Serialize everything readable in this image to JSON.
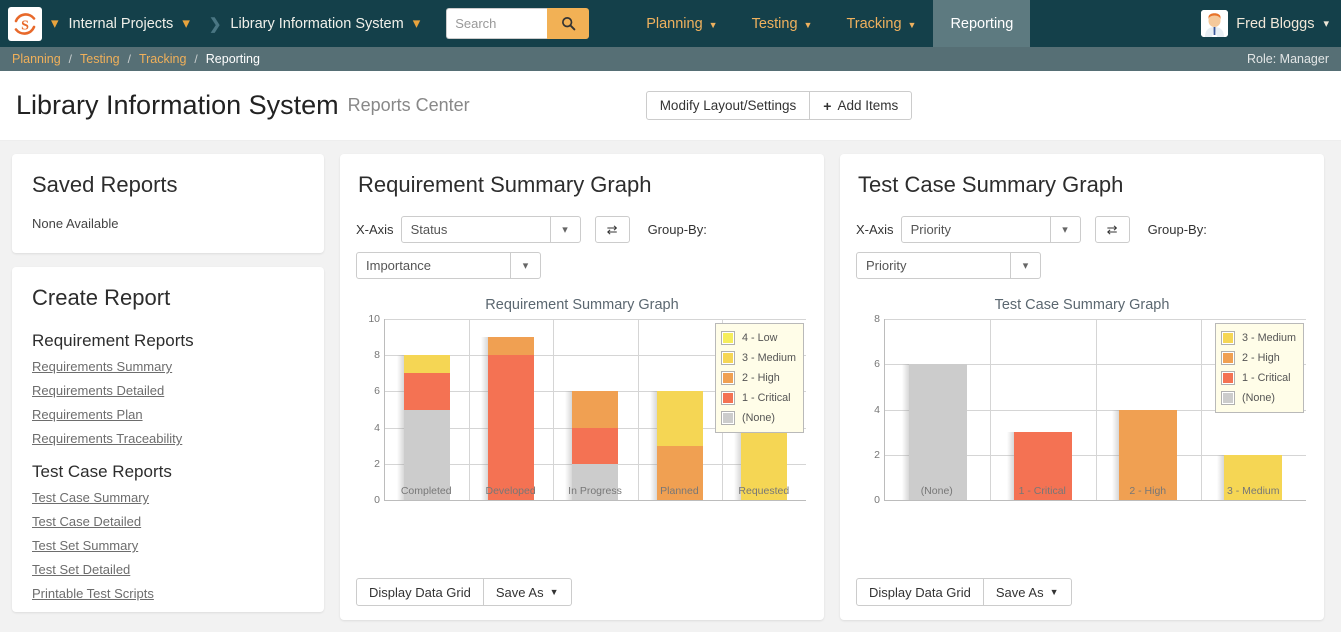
{
  "navbar": {
    "logo_icon": "spira-s-logo-icon",
    "org_caret_icon": "chevron-down-icon",
    "org_name": "Internal Projects",
    "org_dropdown_icon": "chevron-down-icon",
    "separator_icon": "chevron-right-icon",
    "project_name": "Library Information System",
    "project_dropdown_icon": "chevron-down-icon",
    "search_placeholder": "Search",
    "search_value": "",
    "search_icon": "search-icon",
    "menu": [
      {
        "label": "Planning",
        "has_caret": true,
        "active": false
      },
      {
        "label": "Testing",
        "has_caret": true,
        "active": false
      },
      {
        "label": "Tracking",
        "has_caret": true,
        "active": false
      },
      {
        "label": "Reporting",
        "has_caret": false,
        "active": true
      }
    ],
    "user_name": "Fred Bloggs",
    "user_avatar_icon": "user-avatar-icon",
    "user_caret_icon": "chevron-down-icon",
    "bg_color": "#14404a",
    "accent_color": "#efb15e"
  },
  "breadcrumb": {
    "items": [
      "Planning",
      "Testing",
      "Tracking",
      "Reporting"
    ],
    "separator": "/",
    "role_text": "Role: Manager"
  },
  "page_header": {
    "title": "Library Information System",
    "subtitle": "Reports Center",
    "buttons": [
      {
        "label": "Modify Layout/Settings",
        "icon": null
      },
      {
        "label": "Add Items",
        "icon": "plus-icon"
      }
    ]
  },
  "sidebar": {
    "saved_reports": {
      "title": "Saved Reports",
      "empty_text": "None Available"
    },
    "create_report": {
      "title": "Create Report",
      "sections": [
        {
          "heading": "Requirement Reports",
          "links": [
            "Requirements Summary",
            "Requirements Detailed",
            "Requirements Plan",
            "Requirements Traceability"
          ]
        },
        {
          "heading": "Test Case Reports",
          "links": [
            "Test Case Summary",
            "Test Case Detailed",
            "Test Set Summary",
            "Test Set Detailed",
            "Printable Test Scripts"
          ]
        }
      ]
    }
  },
  "panels": [
    {
      "title": "Requirement Summary Graph",
      "xaxis_label": "X-Axis",
      "xaxis_value": "Status",
      "swap_icon": "swap-arrows-icon",
      "groupby_label": "Group-By:",
      "groupby_value": "Importance",
      "footer_buttons": [
        {
          "label": "Display Data Grid",
          "has_caret": false
        },
        {
          "label": "Save As",
          "has_caret": true
        }
      ]
    },
    {
      "title": "Test Case Summary Graph",
      "xaxis_label": "X-Axis",
      "xaxis_value": "Priority",
      "swap_icon": "swap-arrows-icon",
      "groupby_label": "Group-By:",
      "groupby_value": "Priority",
      "footer_buttons": [
        {
          "label": "Display Data Grid",
          "has_caret": false
        },
        {
          "label": "Save As",
          "has_caret": true
        }
      ]
    }
  ],
  "chart_data": [
    {
      "type": "bar",
      "stacked": true,
      "title": "Requirement Summary Graph",
      "xlabel": "",
      "ylabel": "",
      "ylim": [
        0,
        10
      ],
      "yticks": [
        0,
        2,
        4,
        6,
        8,
        10
      ],
      "grid": true,
      "legend_position": "top-right",
      "categories": [
        "Completed",
        "Developed",
        "In Progress",
        "Planned",
        "Requested"
      ],
      "series": [
        {
          "name": "4 - Low",
          "color": "#f5ed5c",
          "values": [
            0,
            0,
            0,
            0,
            0
          ]
        },
        {
          "name": "3 - Medium",
          "color": "#f5d654",
          "values": [
            1,
            0,
            0,
            3,
            6
          ]
        },
        {
          "name": "2 - High",
          "color": "#f0a052",
          "values": [
            0,
            1,
            2,
            3,
            0
          ]
        },
        {
          "name": "1 - Critical",
          "color": "#f47253",
          "values": [
            2,
            8,
            2,
            0,
            0
          ]
        },
        {
          "name": "(None)",
          "color": "#cccccc",
          "values": [
            5,
            0,
            2,
            0,
            0
          ]
        }
      ],
      "totals": [
        8,
        9,
        6,
        6,
        6
      ]
    },
    {
      "type": "bar",
      "stacked": true,
      "title": "Test Case Summary Graph",
      "xlabel": "",
      "ylabel": "",
      "ylim": [
        0,
        8
      ],
      "yticks": [
        0,
        2,
        4,
        6,
        8
      ],
      "grid": true,
      "legend_position": "top-right",
      "categories": [
        "(None)",
        "1 - Critical",
        "2 - High",
        "3 - Medium"
      ],
      "series": [
        {
          "name": "3 - Medium",
          "color": "#f5d654",
          "values": [
            0,
            0,
            0,
            2
          ]
        },
        {
          "name": "2 - High",
          "color": "#f0a052",
          "values": [
            0,
            0,
            4,
            0
          ]
        },
        {
          "name": "1 - Critical",
          "color": "#f47253",
          "values": [
            0,
            3,
            0,
            0
          ]
        },
        {
          "name": "(None)",
          "color": "#cccccc",
          "values": [
            6,
            0,
            0,
            0
          ]
        }
      ],
      "totals": [
        6,
        3,
        4,
        2
      ]
    }
  ]
}
